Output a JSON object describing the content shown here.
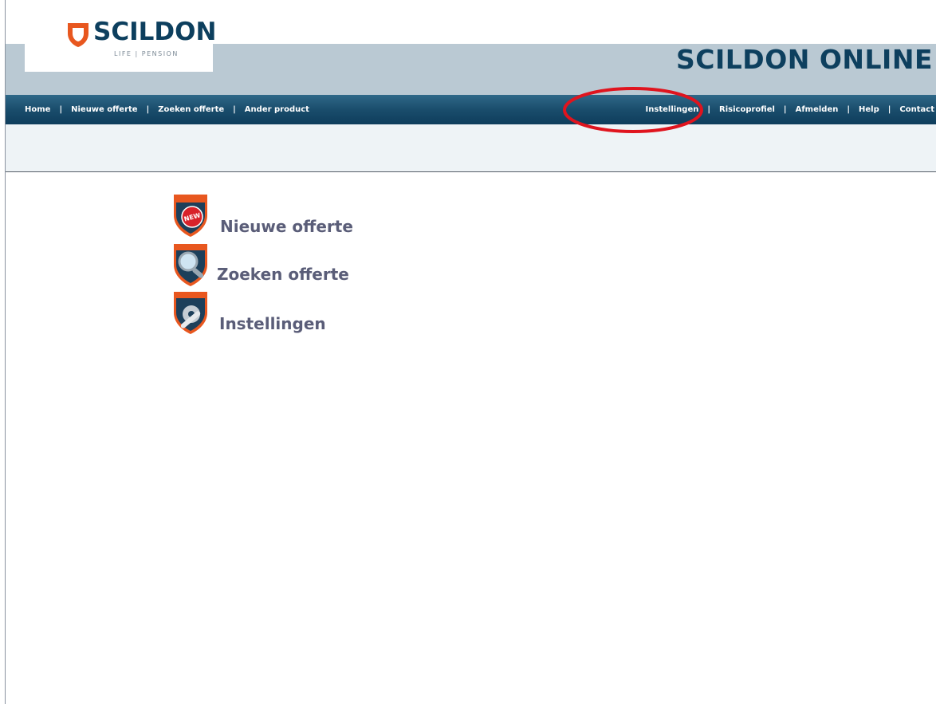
{
  "brand": {
    "logo_name": "SCILDON",
    "logo_tagline": "LIFE | PENSION",
    "site_title": "SCILDON ONLINE"
  },
  "nav": {
    "left": [
      "Home",
      "Nieuwe offerte",
      "Zoeken offerte",
      "Ander product"
    ],
    "right": [
      "Instellingen",
      "Risicoprofiel",
      "Afmelden",
      "Help",
      "Contact"
    ],
    "separator": "|"
  },
  "actions": [
    {
      "label": "Nieuwe offerte",
      "icon": "new-shield-icon",
      "badge": "NEW"
    },
    {
      "label": "Zoeken offerte",
      "icon": "magnifier-shield-icon"
    },
    {
      "label": "Instellingen",
      "icon": "tools-shield-icon"
    }
  ],
  "colors": {
    "brand_navy": "#0d3f5e",
    "brand_orange": "#e8571f",
    "header_band": "#bac9d3",
    "highlight": "#e0141e"
  }
}
